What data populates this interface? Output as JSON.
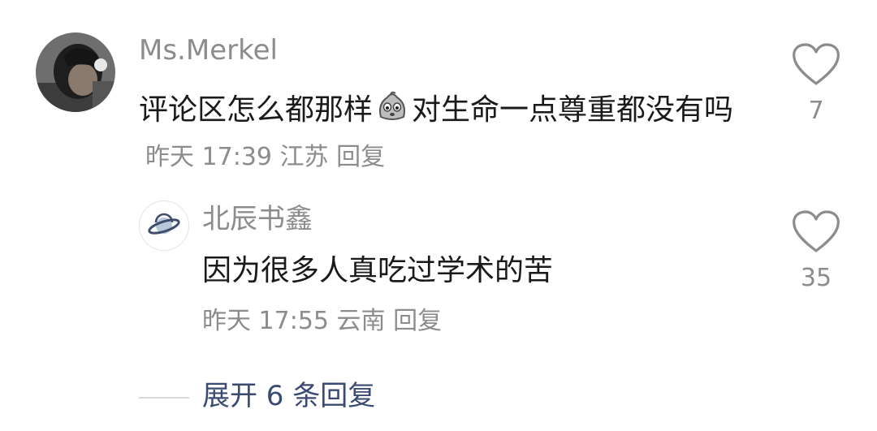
{
  "main_comment": {
    "username": "Ms.Merkel",
    "text_before_emoji": "评论区怎么都那样",
    "text_after_emoji": "对生命一点尊重都没有吗",
    "time": "昨天 17:39",
    "location": "江苏",
    "reply_label": "回复",
    "like_count": "7",
    "emoji": "sad-dumpling-emoji"
  },
  "reply_comment": {
    "username": "北辰书鑫",
    "text": "因为很多人真吃过学术的苦",
    "time": "昨天 17:55",
    "location": "云南",
    "reply_label": "回复",
    "like_count": "35"
  },
  "expand": {
    "label": "展开 6 条回复"
  },
  "colors": {
    "meta_gray": "#8c8c8c",
    "text": "#1a1a1a",
    "expand_link": "#3a4a72"
  }
}
